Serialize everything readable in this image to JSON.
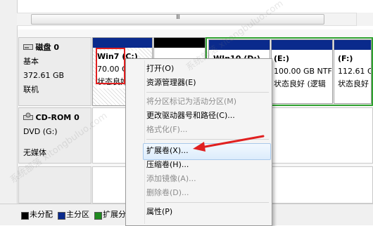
{
  "scrollbar": {
    "grip": "III"
  },
  "disks": [
    {
      "name": "磁盘 0",
      "type": "基本",
      "size": "372.61 GB",
      "status": "联机",
      "partitions": [
        {
          "label": "Win7  (C:)",
          "size": "70.00 G",
          "status": "状态良好"
        },
        {
          "label": "",
          "size": "",
          "status": ""
        },
        {
          "label": "WIn10  (D:)",
          "size": "",
          "status": ""
        },
        {
          "label": "(E:)",
          "size": "100.00 GB NTF",
          "status": "状态良好 (逻辑"
        },
        {
          "label": "(F:)",
          "size": "112.61 GB N",
          "status": "状态良好 (逻"
        }
      ]
    },
    {
      "name": "CD-ROM 0",
      "type": "DVD (G:)",
      "status": "无媒体"
    }
  ],
  "context_menu": {
    "items": [
      {
        "label": "打开(O)",
        "enabled": true
      },
      {
        "label": "资源管理器(E)",
        "enabled": true
      },
      {
        "label": "将分区标记为活动分区(M)",
        "enabled": false
      },
      {
        "label": "更改驱动器号和路径(C)...",
        "enabled": true
      },
      {
        "label": "格式化(F)...",
        "enabled": false
      },
      {
        "label": "扩展卷(X)...",
        "enabled": true,
        "highlighted": true
      },
      {
        "label": "压缩卷(H)...",
        "enabled": true
      },
      {
        "label": "添加镜像(A)...",
        "enabled": false
      },
      {
        "label": "删除卷(D)...",
        "enabled": false
      },
      {
        "label": "属性(P)",
        "enabled": true
      }
    ]
  },
  "legend": [
    {
      "label": "未分配",
      "color": "#000000"
    },
    {
      "label": "主分区",
      "color": "#0a2a8c"
    },
    {
      "label": "扩展分",
      "color": "#1f8a1f"
    }
  ],
  "colors": {
    "primary_band": "#0a2a8c",
    "unallocated_band": "#000000",
    "extended_border": "#2fa12f",
    "annotation_red": "#e02020"
  }
}
